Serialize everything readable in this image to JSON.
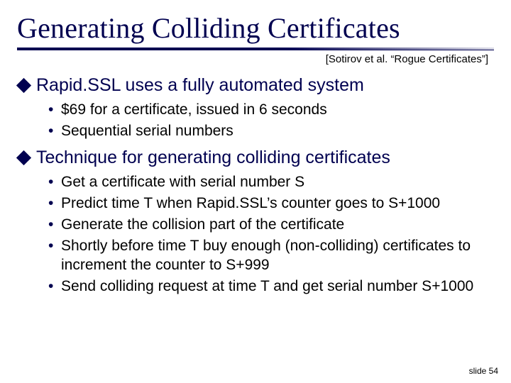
{
  "title": "Generating Colliding Certificates",
  "attribution": "[Sotirov et al. “Rogue Certificates”]",
  "sections": [
    {
      "heading": "Rapid.SSL uses a fully automated system",
      "items": [
        "$69 for a certificate, issued in 6 seconds",
        "Sequential serial numbers"
      ]
    },
    {
      "heading": "Technique for generating colliding certificates",
      "items": [
        "Get a certificate with serial number S",
        "Predict time T when Rapid.SSL’s counter goes to S+1000",
        "Generate the collision part of the certificate",
        "Shortly before time T buy enough (non-colliding) certificates to increment the counter to S+999",
        "Send colliding request at time T and get serial number S+1000"
      ]
    }
  ],
  "footer": "slide 54"
}
